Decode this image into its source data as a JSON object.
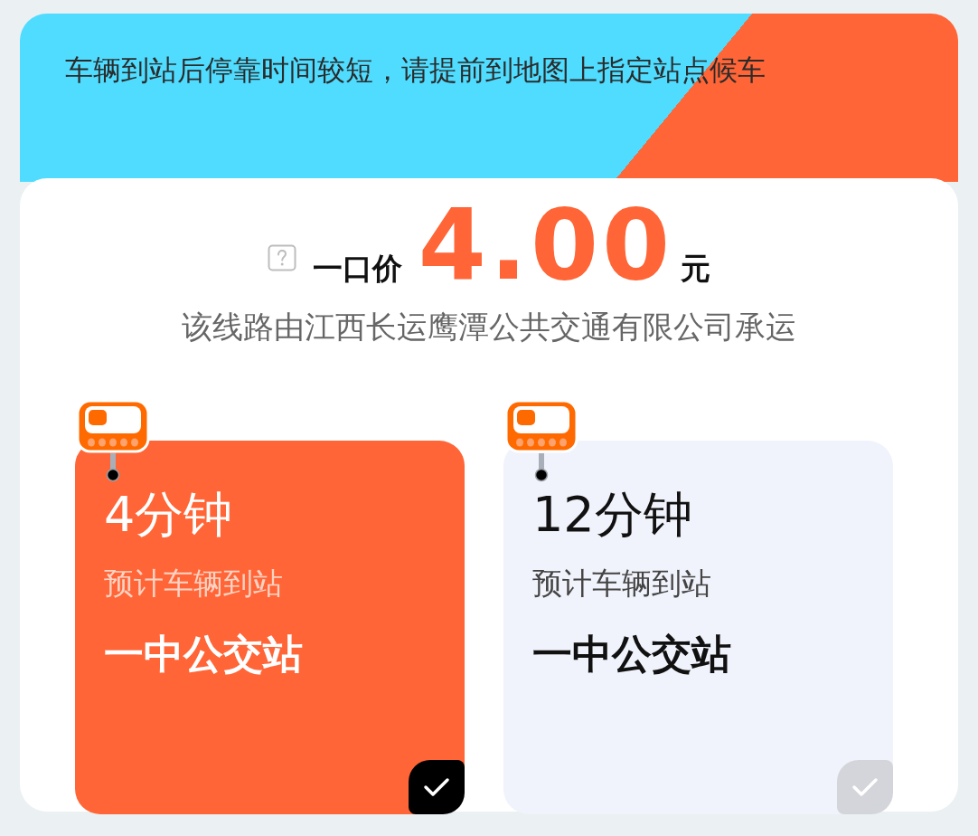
{
  "notice": {
    "text": "车辆到站后停靠时间较短，请提前到地图上指定站点候车"
  },
  "price": {
    "label": "一口价",
    "amount": "4.00",
    "unit": "元"
  },
  "operator_note": "该线路由江西长运鹰潭公共交通有限公司承运",
  "options": [
    {
      "eta": "4分钟",
      "caption": "预计车辆到站",
      "stop": "一中公交站",
      "selected": true
    },
    {
      "eta": "12分钟",
      "caption": "预计车辆到站",
      "stop": "一中公交站",
      "selected": false
    }
  ]
}
